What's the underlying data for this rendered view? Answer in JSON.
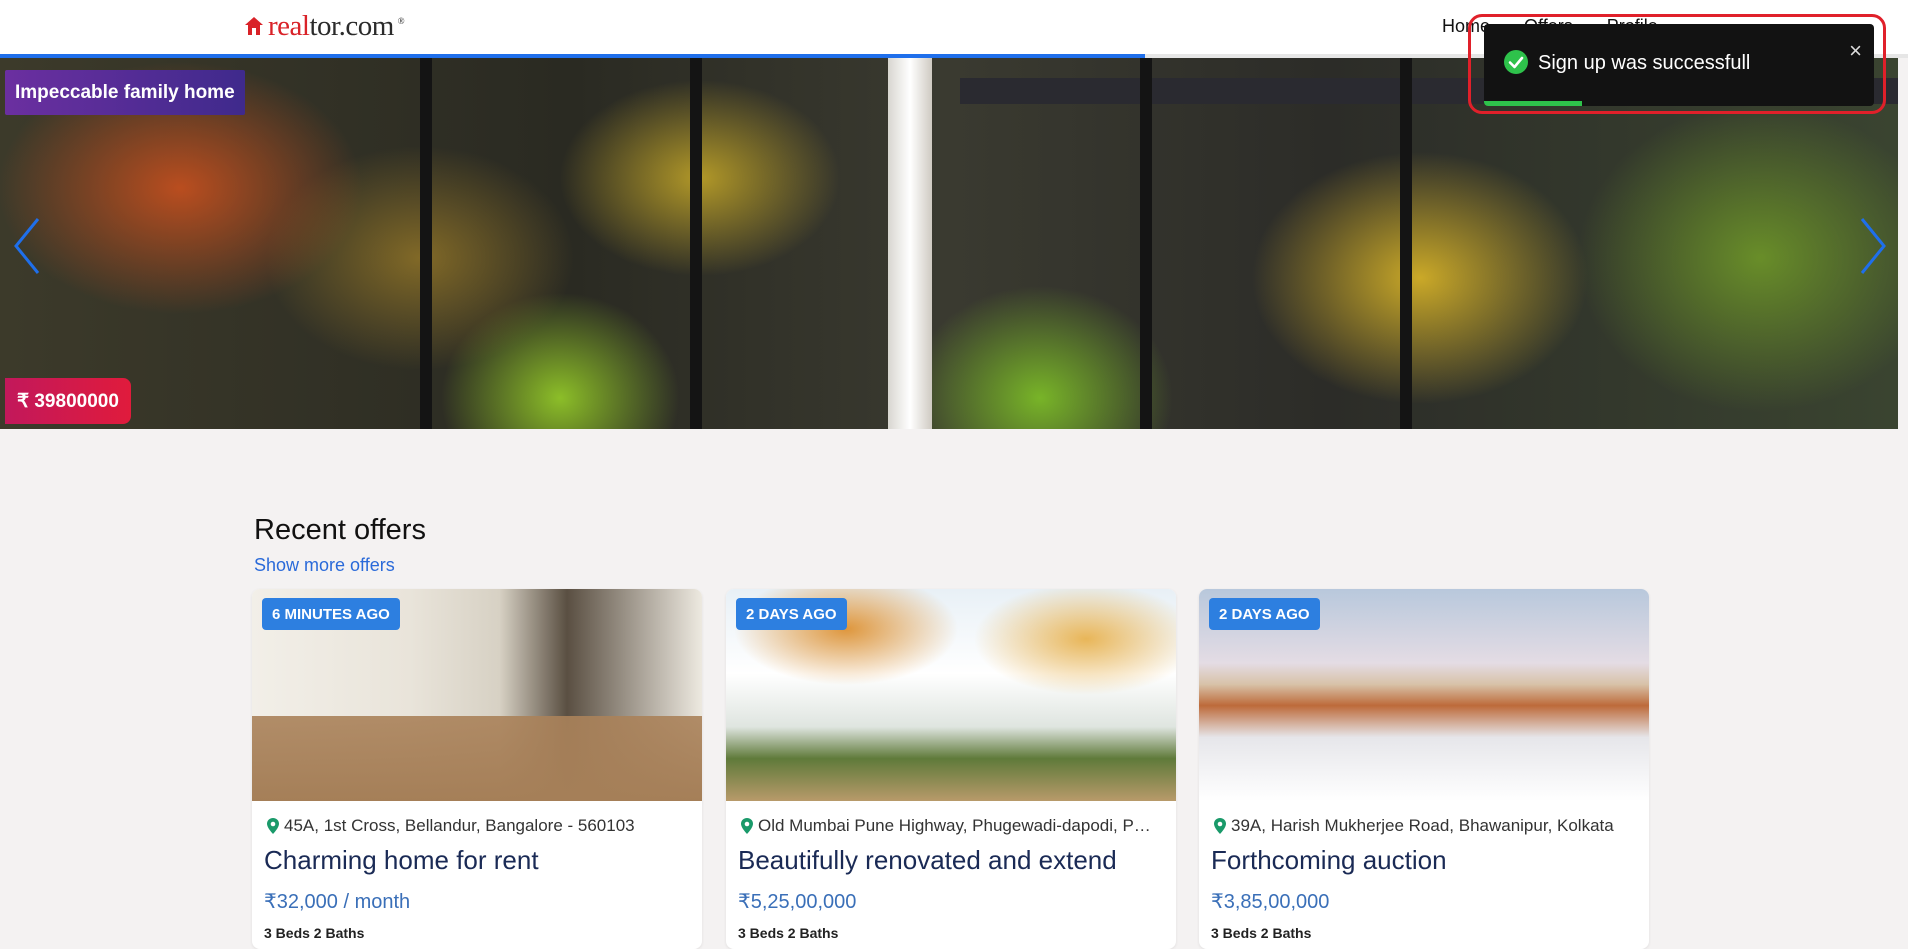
{
  "brand": {
    "logo_red": "real",
    "logo_dark": "tor.com",
    "trademark": "®"
  },
  "nav": {
    "links": [
      "Home",
      "Offers",
      "Profile"
    ]
  },
  "page_progress": 0.6,
  "hero": {
    "caption": "Impeccable family home",
    "price": "₹ 39800000",
    "prev_icon": "chevron-left-icon",
    "next_icon": "chevron-right-icon"
  },
  "toast": {
    "message": "Sign up was successfull",
    "close_label": "×",
    "icon": "check-circle-icon",
    "progress": 0.25,
    "bar_color": "#2ec24b"
  },
  "recent": {
    "title": "Recent offers",
    "show_more": "Show more offers",
    "cards": [
      {
        "badge": "6 MINUTES AGO",
        "location": "45A, 1st Cross, Bellandur, Bangalore - 560103",
        "title": "Charming home for rent",
        "price": "₹32,000 / month",
        "details": "3 Beds  2 Baths"
      },
      {
        "badge": "2 DAYS AGO",
        "location": "Old Mumbai Pune Highway, Phugewadi-dapodi, Pune",
        "title": "Beautifully renovated and extend",
        "price": "₹5,25,00,000",
        "details": "3 Beds  2 Baths"
      },
      {
        "badge": "2 DAYS AGO",
        "location": "39A, Harish Mukherjee Road, Bhawanipur, Kolkata",
        "title": "Forthcoming auction",
        "price": "₹3,85,00,000",
        "details": "3 Beds  2 Baths"
      }
    ]
  },
  "colors": {
    "accent": "#1f6feb",
    "pin": "#1a9a6a",
    "badge": "#2d7fe0",
    "toast_border": "#e0202a"
  }
}
